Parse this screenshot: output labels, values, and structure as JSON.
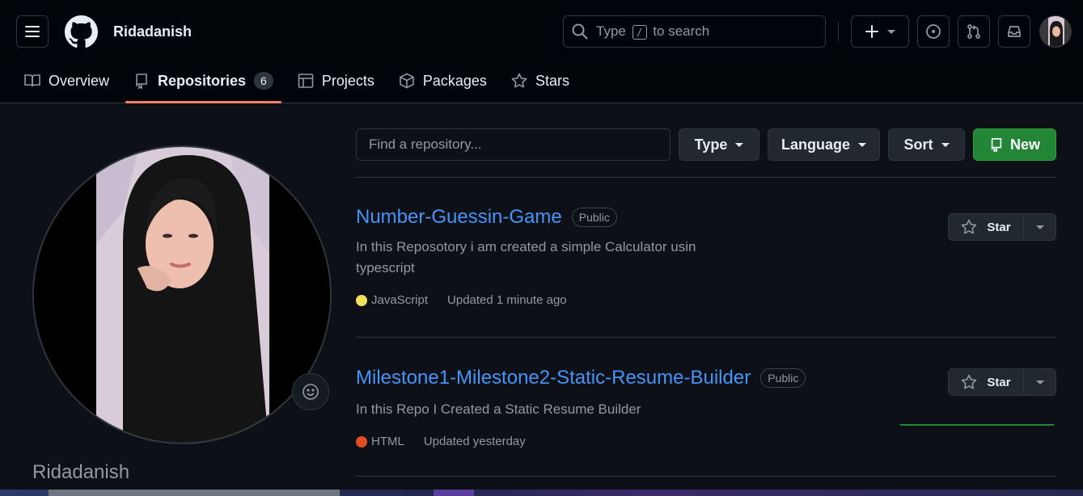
{
  "header": {
    "username": "Ridadanish",
    "search": {
      "prefix": "Type",
      "key": "/",
      "suffix": "to search"
    }
  },
  "tabs": [
    {
      "label": "Overview"
    },
    {
      "label": "Repositories",
      "count": "6"
    },
    {
      "label": "Projects"
    },
    {
      "label": "Packages"
    },
    {
      "label": "Stars"
    }
  ],
  "profile": {
    "name": "Ridadanish"
  },
  "filters": {
    "find_placeholder": "Find a repository...",
    "type_label": "Type",
    "language_label": "Language",
    "sort_label": "Sort",
    "new_label": "New"
  },
  "repos": [
    {
      "name": "Number-Guessin-Game",
      "visibility": "Public",
      "description": "In this Reposotory i am created a simple Calculator usin typescript",
      "language": "JavaScript",
      "language_color": "#f1e05a",
      "updated": "Updated 1 minute ago",
      "star_label": "Star"
    },
    {
      "name": "Milestone1-Milestone2-Static-Resume-Builder",
      "visibility": "Public",
      "description": "In this Repo I Created a Static Resume Builder",
      "language": "HTML",
      "language_color": "#e34c26",
      "updated": "Updated yesterday",
      "star_label": "Star"
    }
  ],
  "colors": {
    "background": "#0d1117",
    "header_bg": "#010409",
    "link": "#4493f8",
    "accent_tab": "#f78166",
    "primary_button": "#238636"
  }
}
